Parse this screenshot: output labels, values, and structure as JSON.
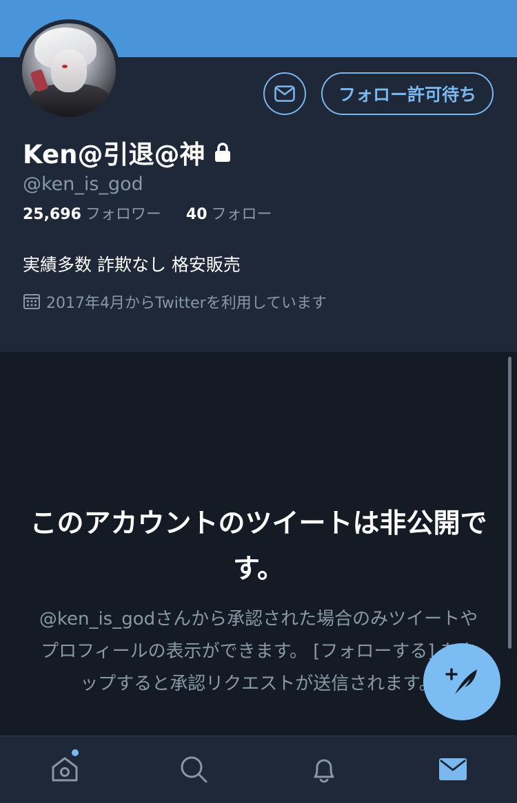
{
  "profile": {
    "display_name": "Ken@引退@神",
    "handle": "@ken_is_god",
    "followers_count": "25,696",
    "followers_label": "フォロワー",
    "following_count": "40",
    "following_label": "フォロー",
    "bio": "実績多数 詐欺なし 格安販売",
    "joined": "2017年4月からTwitterを利用しています",
    "follow_button_label": "フォロー許可待ち"
  },
  "private_notice": {
    "title": "このアカウントのツイートは非公開です。",
    "description": "@ken_is_godさんから承認された場合のみツイートやプロフィールの表示ができます。 [フォローする] をタップすると承認リクエストが送信されます。"
  },
  "icons": {
    "dm": "envelope-icon",
    "lock": "lock-icon",
    "calendar": "calendar-icon",
    "compose": "compose-tweet-icon",
    "home": "home-icon",
    "search": "search-icon",
    "notifications": "bell-icon",
    "messages": "envelope-icon"
  },
  "colors": {
    "banner": "#4a94da",
    "accent": "#7ab8ef",
    "profile_bg": "#1e2838",
    "page_bg": "#141b24",
    "secondary_text": "#8899a6",
    "fab": "#7bbcf3"
  }
}
